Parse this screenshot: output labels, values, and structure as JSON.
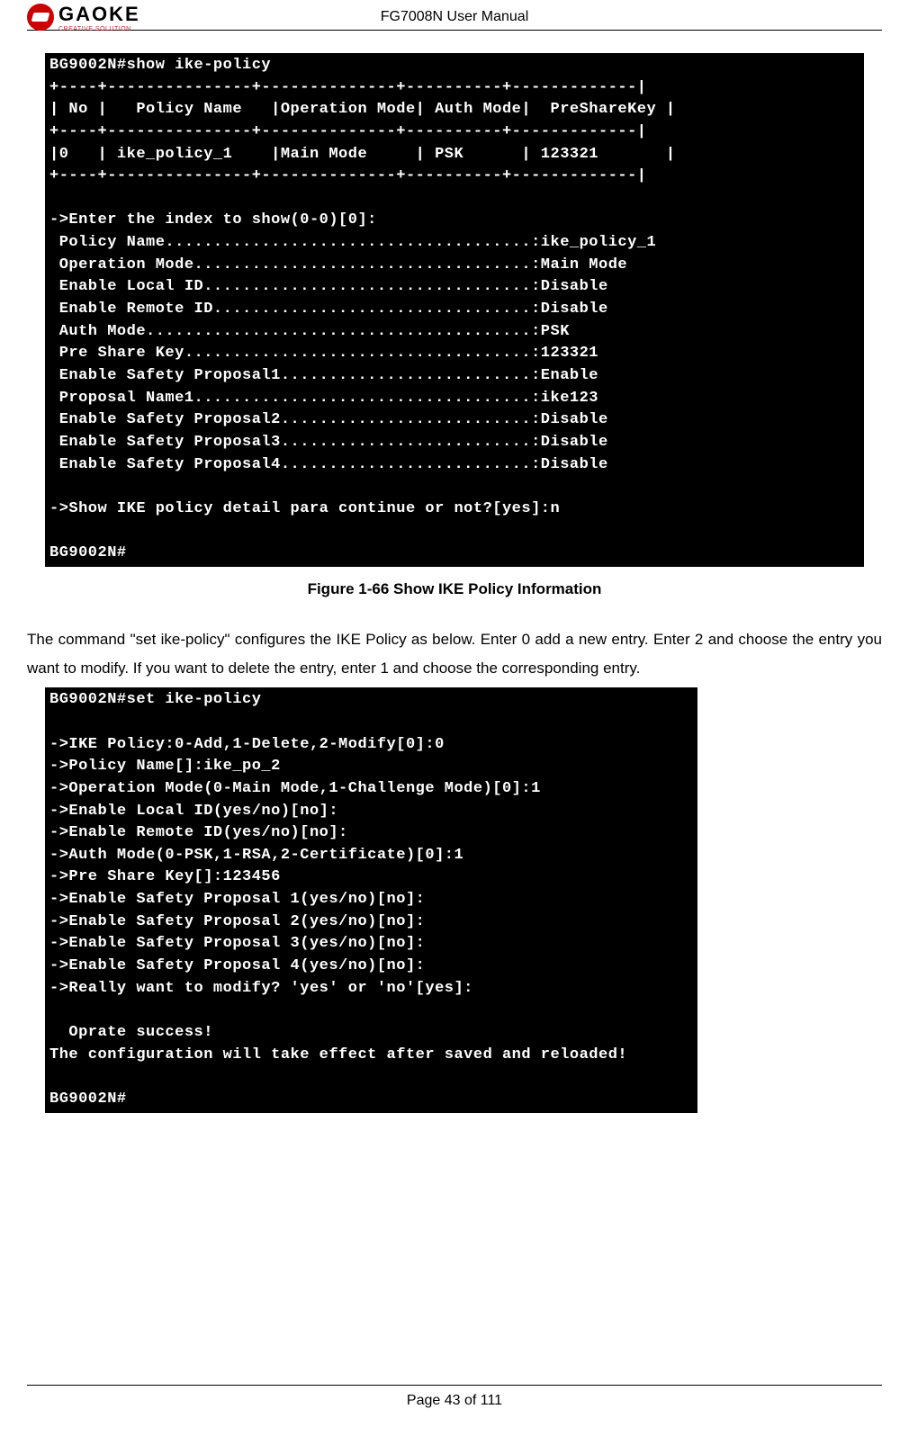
{
  "header": {
    "logo_text": "GAOKE",
    "logo_tagline": "CREATIVE SOLUTION",
    "title": "FG7008N User Manual"
  },
  "terminal1": {
    "lines": [
      "BG9002N#show ike-policy",
      "+----+---------------+--------------+----------+-------------|",
      "| No |   Policy Name   |Operation Mode| Auth Mode|  PreShareKey |",
      "+----+---------------+--------------+----------+-------------|",
      "|0   | ike_policy_1    |Main Mode     | PSK      | 123321       |",
      "+----+---------------+--------------+----------+-------------|",
      "",
      "->Enter the index to show(0-0)[0]:",
      " Policy Name......................................:ike_policy_1",
      " Operation Mode...................................:Main Mode",
      " Enable Local ID..................................:Disable",
      " Enable Remote ID.................................:Disable",
      " Auth Mode........................................:PSK",
      " Pre Share Key....................................:123321",
      " Enable Safety Proposal1..........................:Enable",
      " Proposal Name1...................................:ike123",
      " Enable Safety Proposal2..........................:Disable",
      " Enable Safety Proposal3..........................:Disable",
      " Enable Safety Proposal4..........................:Disable",
      "",
      "->Show IKE policy detail para continue or not?[yes]:n",
      "",
      "BG9002N#"
    ]
  },
  "figure_caption": "Figure 1-66    Show IKE Policy Information",
  "body_paragraph": "The command \"set ike-policy\" configures the IKE Policy as below. Enter 0 add a new entry. Enter 2 and choose the entry you want to modify. If you want to delete the entry, enter 1 and choose the corresponding entry.",
  "terminal2": {
    "lines": [
      "BG9002N#set ike-policy",
      "",
      "->IKE Policy:0-Add,1-Delete,2-Modify[0]:0",
      "->Policy Name[]:ike_po_2",
      "->Operation Mode(0-Main Mode,1-Challenge Mode)[0]:1",
      "->Enable Local ID(yes/no)[no]:",
      "->Enable Remote ID(yes/no)[no]:",
      "->Auth Mode(0-PSK,1-RSA,2-Certificate)[0]:1",
      "->Pre Share Key[]:123456",
      "->Enable Safety Proposal 1(yes/no)[no]:",
      "->Enable Safety Proposal 2(yes/no)[no]:",
      "->Enable Safety Proposal 3(yes/no)[no]:",
      "->Enable Safety Proposal 4(yes/no)[no]:",
      "->Really want to modify? 'yes' or 'no'[yes]:",
      "",
      "  Oprate success!",
      "The configuration will take effect after saved and reloaded!",
      "",
      "BG9002N#"
    ]
  },
  "footer": "Page 43 of 111"
}
